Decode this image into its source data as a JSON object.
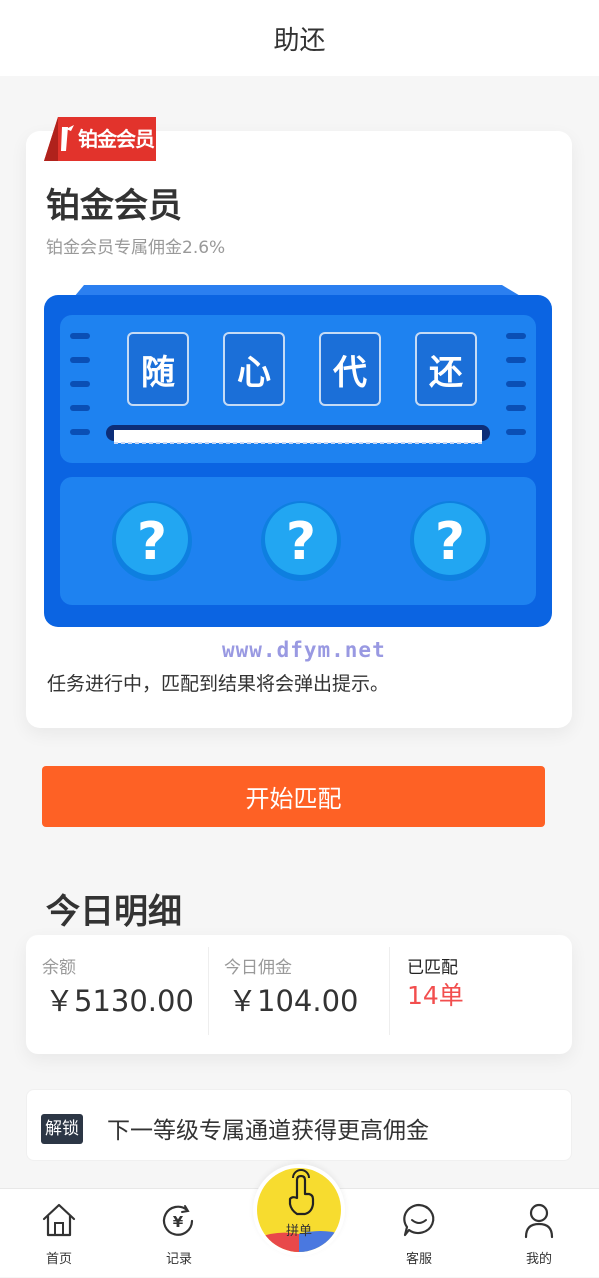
{
  "header": {
    "title": "助还"
  },
  "member": {
    "badge_text": "铂金会员",
    "title": "铂金会员",
    "subtitle": "铂金会员专属佣金2.6%",
    "slot_chars": [
      "随",
      "心",
      "代",
      "还"
    ],
    "watermark": "www.dfym.net",
    "status_text": "任务进行中，匹配到结果将会弹出提示。"
  },
  "actions": {
    "start_label": "开始匹配"
  },
  "today": {
    "title": "今日明细",
    "balance_label": "余额",
    "balance_value": "￥5130.00",
    "commission_label": "今日佣金",
    "commission_value": "￥104.00",
    "matched_label": "已匹配",
    "matched_value": "14单"
  },
  "unlock": {
    "tag": "解锁",
    "text": "下一等级专属通道获得更高佣金"
  },
  "nav": {
    "home": "首页",
    "records": "记录",
    "center": "拼单",
    "service": "客服",
    "mine": "我的"
  },
  "colors": {
    "accent_orange": "#fe6125",
    "matched_red": "#f24e4e",
    "badge_red": "#e2332c",
    "machine_blue": "#0f6fe6",
    "center_yellow": "#f7dc2f"
  }
}
